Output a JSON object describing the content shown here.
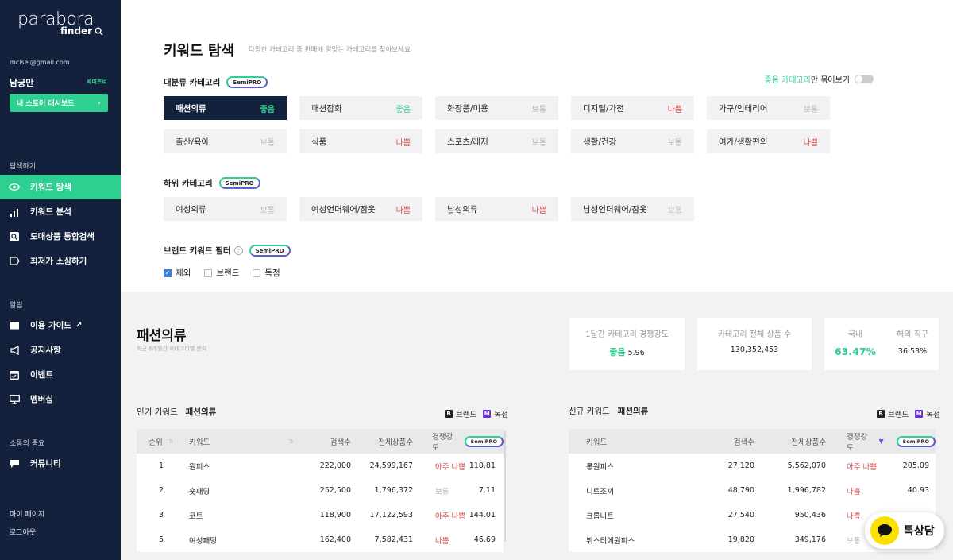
{
  "sidebar": {
    "logo": "parabora",
    "logo_sub": "finder",
    "email": "mcisel@gmail.com",
    "user_name": "남궁만",
    "plan": "세미프로",
    "store_button": "내 스토어 대시보드",
    "explore_section": "탐색하기",
    "nav": [
      {
        "label": "키워드 탐색",
        "icon": "eye-icon"
      },
      {
        "label": "키워드 분석",
        "icon": "chart-icon"
      },
      {
        "label": "도매상품 통합검색",
        "icon": "search-box-icon"
      },
      {
        "label": "최저가 소싱하기",
        "icon": "tag-icon"
      }
    ],
    "notice_section": "알림",
    "notice_nav": [
      {
        "label": "이용 가이드",
        "icon": "book-icon"
      },
      {
        "label": "공지사항",
        "icon": "megaphone-icon"
      },
      {
        "label": "이벤트",
        "icon": "calendar-icon"
      },
      {
        "label": "멤버십",
        "icon": "monitor-icon"
      }
    ],
    "community_section": "소통의 중요",
    "community_item": "커뮤니티",
    "mypage": "마이 페이지",
    "logout": "로그아웃"
  },
  "header": {
    "title": "키워드 탐색",
    "description": "다양한 카테고리 중 판매에 알맞는 카테고리를 찾아보세요",
    "toggle_green": "좋음 카테고리",
    "toggle_rest": "만 묶어보기"
  },
  "badge": "SemiPRO",
  "main_category": {
    "label": "대분류 카테고리",
    "items": [
      {
        "name": "패션의류",
        "status": "좋음",
        "level": "good",
        "selected": true
      },
      {
        "name": "패션잡화",
        "status": "좋음",
        "level": "good"
      },
      {
        "name": "화장품/미용",
        "status": "보통",
        "level": "normal"
      },
      {
        "name": "디지털/가전",
        "status": "나쁨",
        "level": "bad"
      },
      {
        "name": "가구/인테리어",
        "status": "보통",
        "level": "normal"
      },
      {
        "name": "출산/육아",
        "status": "보통",
        "level": "normal"
      },
      {
        "name": "식품",
        "status": "나쁨",
        "level": "bad"
      },
      {
        "name": "스포츠/레저",
        "status": "보통",
        "level": "normal"
      },
      {
        "name": "생활/건강",
        "status": "보통",
        "level": "normal"
      },
      {
        "name": "여가/생활편의",
        "status": "나쁨",
        "level": "bad"
      }
    ]
  },
  "sub_category": {
    "label": "하위 카테고리",
    "items": [
      {
        "name": "여성의류",
        "status": "보통",
        "level": "normal"
      },
      {
        "name": "여성언더웨어/잠옷",
        "status": "나쁨",
        "level": "bad"
      },
      {
        "name": "남성의류",
        "status": "나쁨",
        "level": "bad"
      },
      {
        "name": "남성언더웨어/잠옷",
        "status": "보통",
        "level": "normal"
      }
    ]
  },
  "brand_filter": {
    "label": "브랜드 키워드 필터",
    "options": [
      {
        "label": "제외",
        "checked": true
      },
      {
        "label": "브랜드",
        "checked": false
      },
      {
        "label": "독점",
        "checked": false
      }
    ]
  },
  "summary": {
    "title": "패션의류",
    "subtitle": "최근 6개월간 카테고리별 분석",
    "competition_label": "1달간 카테고리 경쟁강도",
    "competition_status": "좋음",
    "competition_value": "5.96",
    "total_label": "카테고리 전체 상품 수",
    "total_value": "130,352,453",
    "domestic_label": "국내",
    "domestic_value": "63.47%",
    "overseas_label": "해외 직구",
    "overseas_value": "36.53%"
  },
  "legend": {
    "brand": "브랜드",
    "exclusive": "독점",
    "brand_letter": "B",
    "exclusive_letter": "M",
    "brand_color": "#222222",
    "exclusive_color": "#6a2fc8"
  },
  "popular": {
    "title": "인기 키워드",
    "category": "패션의류",
    "columns": [
      "순위",
      "키워드",
      "검색수",
      "전체상품수",
      "경쟁강도"
    ],
    "rows": [
      {
        "rank": "1",
        "keyword": "원피스",
        "search": "222,000",
        "products": "24,599,167",
        "level_text": "아주 나쁨",
        "level": "bad",
        "score": "110.81"
      },
      {
        "rank": "2",
        "keyword": "숏패딩",
        "search": "252,500",
        "products": "1,796,372",
        "level_text": "보통",
        "level": "normal",
        "score": "7.11"
      },
      {
        "rank": "3",
        "keyword": "코트",
        "search": "118,900",
        "products": "17,122,593",
        "level_text": "아주 나쁨",
        "level": "bad",
        "score": "144.01"
      },
      {
        "rank": "5",
        "keyword": "여성패딩",
        "search": "162,400",
        "products": "7,582,431",
        "level_text": "나쁨",
        "level": "bad",
        "score": "46.69"
      }
    ]
  },
  "new": {
    "title": "신규 키워드",
    "category": "패션의류",
    "columns": [
      "키워드",
      "검색수",
      "전체상품수",
      "경쟁강도"
    ],
    "rows": [
      {
        "keyword": "롱원피스",
        "search": "27,120",
        "products": "5,562,070",
        "level_text": "아주 나쁨",
        "level": "bad",
        "score": "205.09"
      },
      {
        "keyword": "니트조끼",
        "search": "48,790",
        "products": "1,996,782",
        "level_text": "나쁨",
        "level": "bad",
        "score": "40.93"
      },
      {
        "keyword": "크롭니트",
        "search": "27,540",
        "products": "950,436",
        "level_text": "나쁨",
        "level": "bad",
        "score": ""
      },
      {
        "keyword": "뷔스티에원피스",
        "search": "19,820",
        "products": "349,176",
        "level_text": "보통",
        "level": "normal",
        "score": ""
      }
    ]
  },
  "chat": {
    "label": "톡상담",
    "bubble_color": "#fae100"
  }
}
